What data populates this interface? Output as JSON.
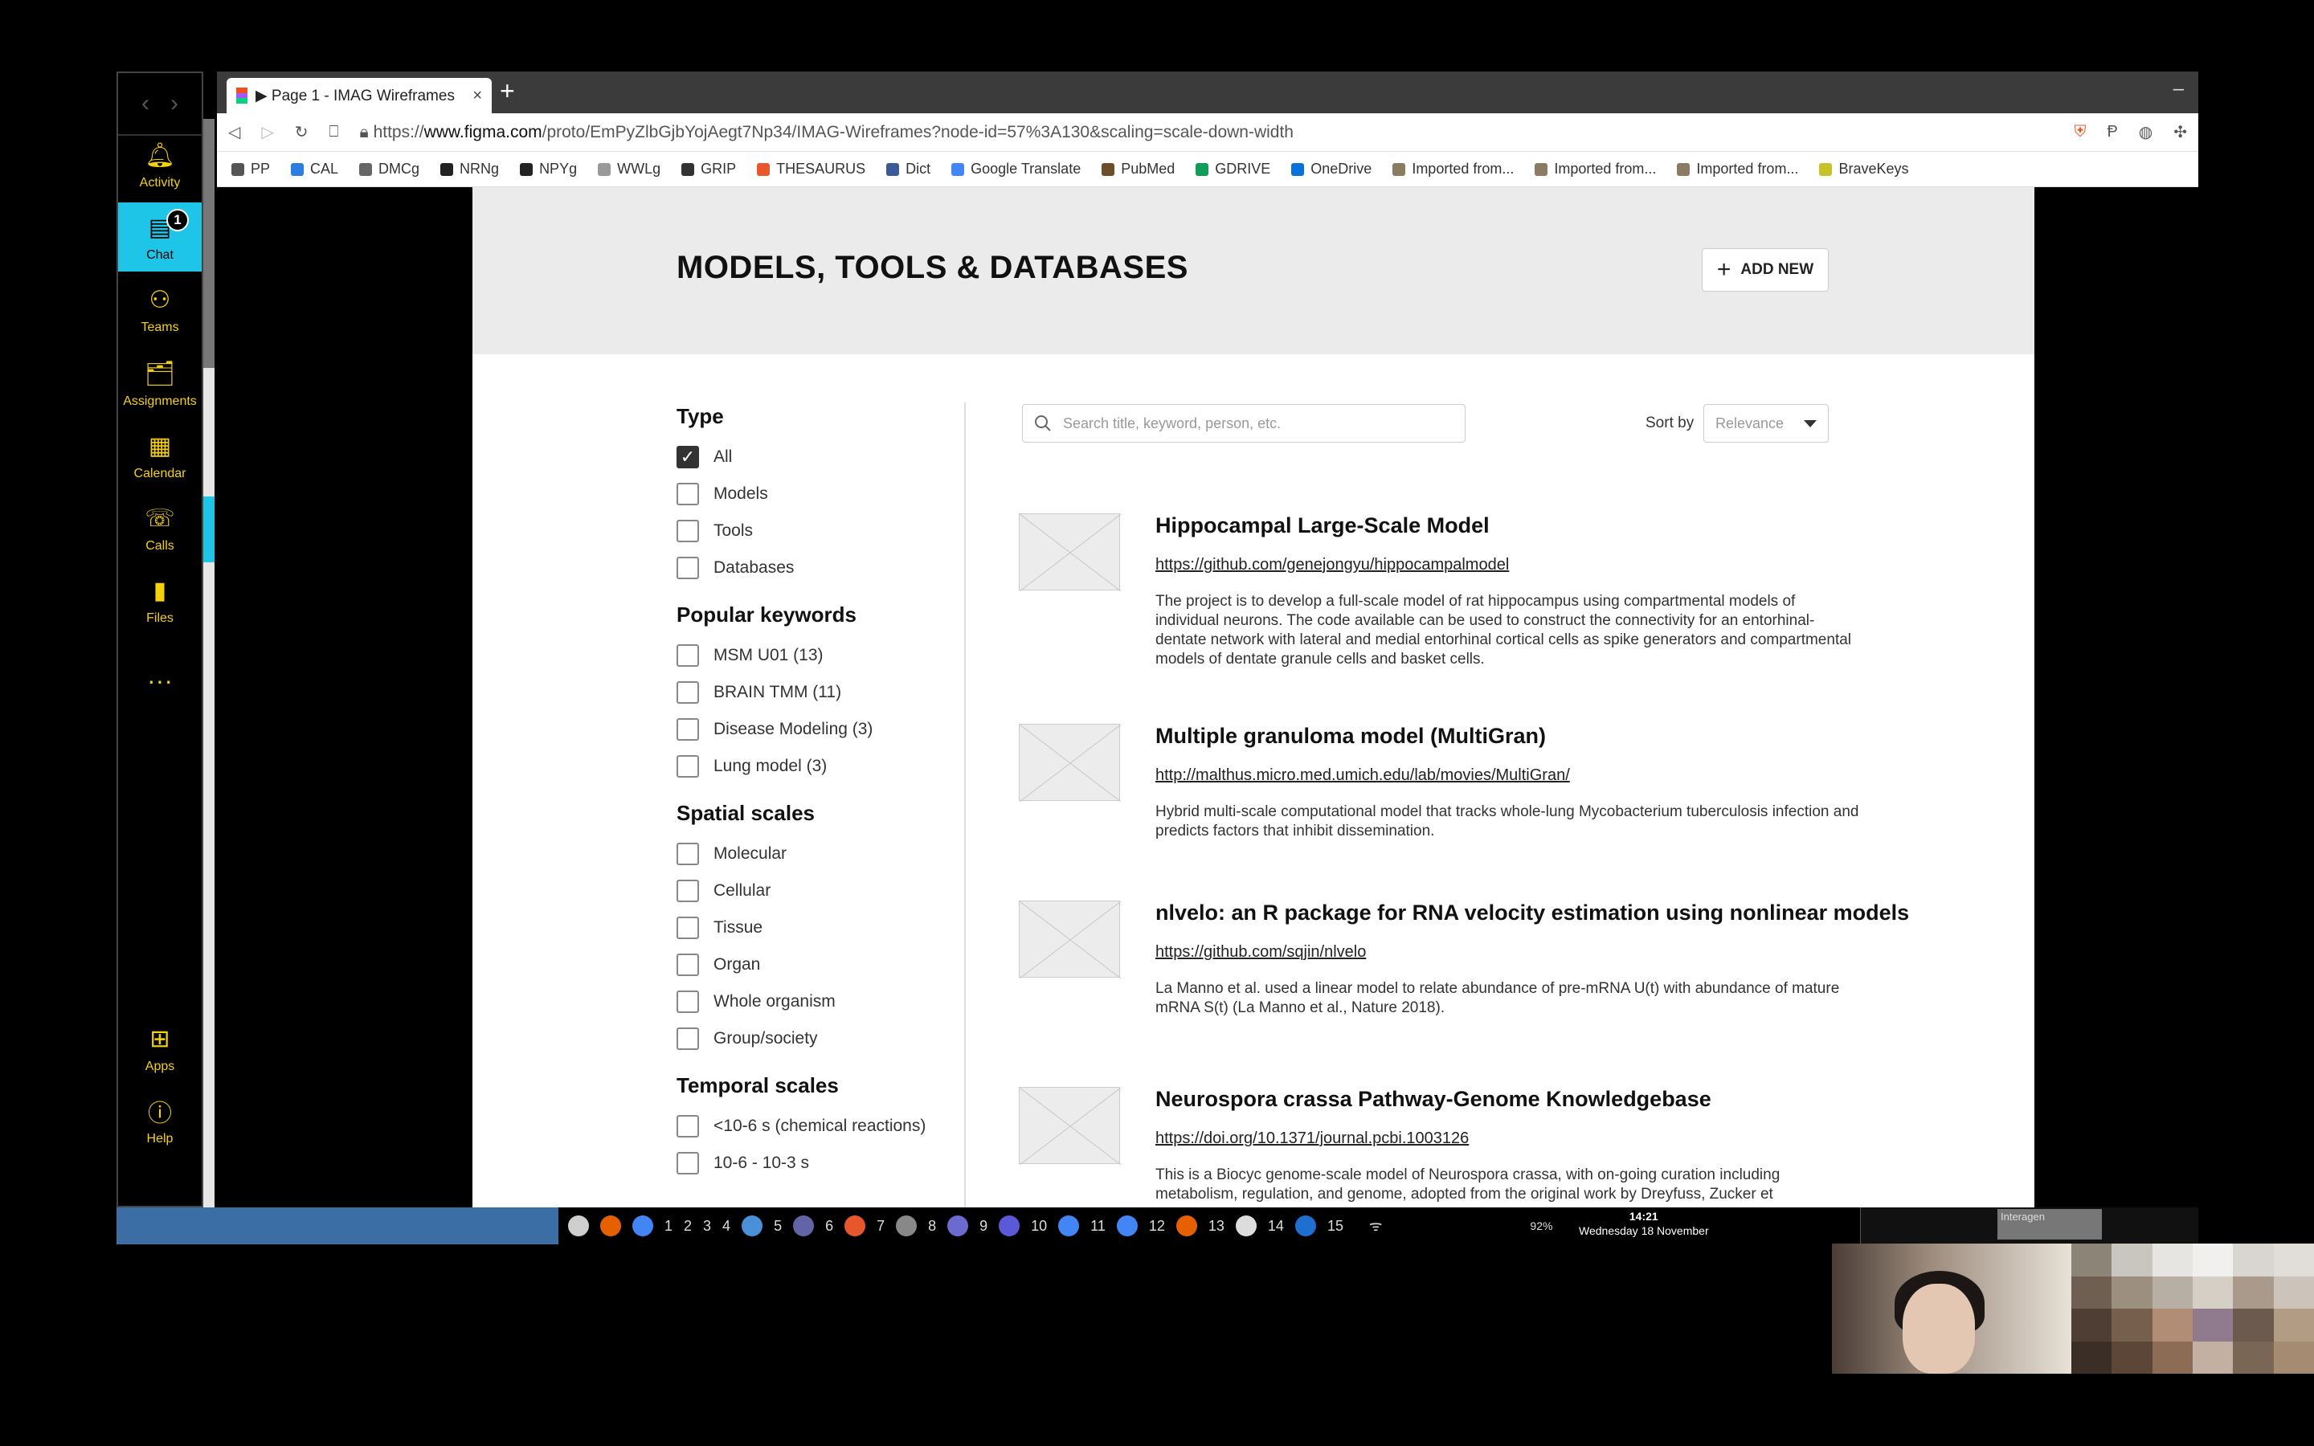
{
  "teams": {
    "items": [
      {
        "label": "Activity",
        "icon": "bell-icon"
      },
      {
        "label": "Chat",
        "icon": "chat-icon",
        "badge": "1",
        "active": true
      },
      {
        "label": "Teams",
        "icon": "teams-icon"
      },
      {
        "label": "Assignments",
        "icon": "assignments-icon"
      },
      {
        "label": "Calendar",
        "icon": "calendar-icon"
      },
      {
        "label": "Calls",
        "icon": "phone-icon"
      },
      {
        "label": "Files",
        "icon": "file-icon"
      },
      {
        "label": "...",
        "icon": "more-icon"
      },
      {
        "label": "Apps",
        "icon": "apps-icon"
      },
      {
        "label": "Help",
        "icon": "help-icon"
      }
    ],
    "accent": "#1fc5e6",
    "icon_color": "#f5d10b"
  },
  "browser": {
    "tab_title": "▶ Page 1 - IMAG Wireframes",
    "url_prefix": "https://",
    "url_host": "www.figma.com",
    "url_path": "/proto/EmPyZlbGjbYojAegt7Np34/IMAG-Wireframes?node-id=57%3A130&scaling=scale-down-width",
    "bookmarks": [
      "PP",
      "CAL",
      "DMCg",
      "NRNg",
      "NPYg",
      "WWLg",
      "GRIP",
      "THESAURUS",
      "Dict",
      "Google Translate",
      "PubMed",
      "GDRIVE",
      "OneDrive",
      "Imported from...",
      "Imported from...",
      "Imported from...",
      "BraveKeys"
    ]
  },
  "page": {
    "title": "MODELS, TOOLS & DATABASES",
    "add_new": "ADD NEW",
    "search_placeholder": "Search title, keyword, person, etc.",
    "sort_label": "Sort by",
    "sort_value": "Relevance",
    "filters": [
      {
        "heading": "Type",
        "options": [
          {
            "label": "All",
            "checked": true
          },
          {
            "label": "Models",
            "checked": false
          },
          {
            "label": "Tools",
            "checked": false
          },
          {
            "label": "Databases",
            "checked": false
          }
        ]
      },
      {
        "heading": "Popular keywords",
        "options": [
          {
            "label": "MSM U01 (13)",
            "checked": false
          },
          {
            "label": "BRAIN TMM (11)",
            "checked": false
          },
          {
            "label": "Disease Modeling (3)",
            "checked": false
          },
          {
            "label": "Lung model (3)",
            "checked": false
          }
        ]
      },
      {
        "heading": "Spatial scales",
        "options": [
          {
            "label": "Molecular",
            "checked": false
          },
          {
            "label": "Cellular",
            "checked": false
          },
          {
            "label": "Tissue",
            "checked": false
          },
          {
            "label": "Organ",
            "checked": false
          },
          {
            "label": "Whole organism",
            "checked": false
          },
          {
            "label": "Group/society",
            "checked": false
          }
        ]
      },
      {
        "heading": "Temporal scales",
        "options": [
          {
            "label": "<10-6 s (chemical reactions)",
            "checked": false
          },
          {
            "label": "10-6 - 10-3 s",
            "checked": false
          }
        ]
      }
    ],
    "results": [
      {
        "title": "Hippocampal Large-Scale Model",
        "link": "https://github.com/genejongyu/hippocampalmodel",
        "desc": "The project is to develop a full-scale model of rat hippocampus using compartmental models of individual neurons. The code available can be used to construct the connectivity for an entorhinal-dentate network with lateral and medial entorhinal cortical cells as spike generators and compartmental models of dentate granule cells and basket cells."
      },
      {
        "title": "Multiple granuloma model (MultiGran)",
        "link": "http://malthus.micro.med.umich.edu/lab/movies/MultiGran/",
        "desc": "Hybrid multi-scale computational model that tracks whole-lung Mycobacterium tuberculosis infection and predicts factors that inhibit dissemination."
      },
      {
        "title": "nlvelo: an R package for RNA velocity estimation using nonlinear models",
        "link": "https://github.com/sqjin/nlvelo",
        "desc": "La Manno et al. used a linear model to relate abundance of pre-mRNA U(t) with abundance of mature mRNA S(t) (La Manno et al., Nature 2018)."
      },
      {
        "title": "Neurospora crassa Pathway-Genome Knowledgebase",
        "link": "https://doi.org/10.1371/journal.pcbi.1003126",
        "desc": "This is a Biocyc genome-scale model of Neurospora crassa, with on-going curation including metabolism, regulation, and genome, adopted from the original work by Dreyfuss, Zucker et"
      }
    ]
  },
  "taskbar": {
    "workspaces": [
      "1",
      "2",
      "3",
      "4",
      "5",
      "6",
      "7",
      "8",
      "9",
      "10",
      "11",
      "12",
      "13",
      "14",
      "15"
    ],
    "time": "14:21",
    "date": "Wednesday 18 November",
    "battery": "92%",
    "battery_state": "Full",
    "pager_label": "Interagen"
  }
}
